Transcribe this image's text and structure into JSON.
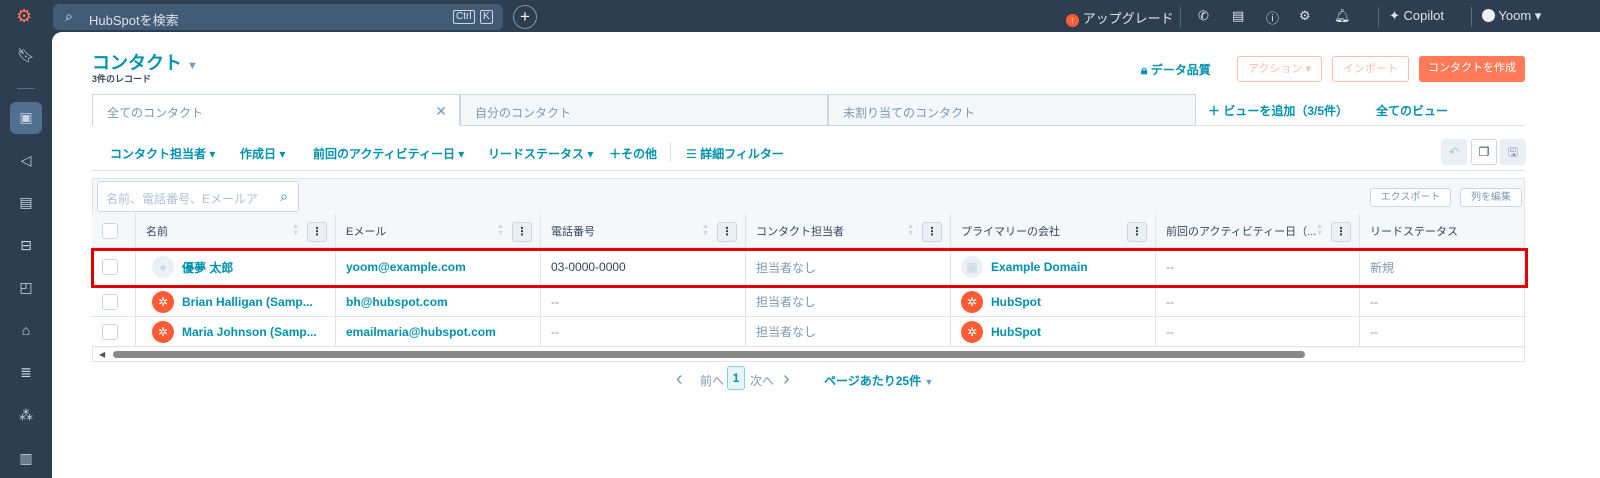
{
  "topbar": {
    "search_placeholder": "HubSpotを検索",
    "kbd_ctrl": "Ctrl",
    "kbd_k": "K",
    "upgrade": "アップグレード",
    "copilot": "Copilot",
    "user": "Yoom"
  },
  "header": {
    "title": "コンタクト",
    "record_count": "3件のレコード",
    "data_quality": "データ品質",
    "actions": "アクション",
    "import": "インポート",
    "create": "コンタクトを作成"
  },
  "tabs": [
    {
      "label": "全てのコンタクト"
    },
    {
      "label": "自分のコンタクト"
    },
    {
      "label": "未割り当てのコンタクト"
    }
  ],
  "add_view": "ビューを追加（3/5件）",
  "all_views": "全てのビュー",
  "filters": {
    "owner": "コンタクト担当者",
    "created": "作成日",
    "last_activity": "前回のアクティビティー日",
    "lead_status": "リードステータス",
    "more": "その他",
    "advanced": "詳細フィルター"
  },
  "table": {
    "search_placeholder": "名前、電話番号、Eメールア",
    "export": "エクスポート",
    "edit_columns": "列を編集",
    "columns": [
      "名前",
      "Eメール",
      "電話番号",
      "コンタクト担当者",
      "プライマリーの会社",
      "前回のアクティビティー日（...",
      "リードステータス"
    ],
    "rows": [
      {
        "name": "優夢 太郎",
        "email": "yoom@example.com",
        "phone": "03-0000-0000",
        "owner": "担当者なし",
        "company": "Example Domain",
        "last_activity": "--",
        "lead_status": "新規",
        "highlighted": true
      },
      {
        "name": "Brian Halligan (Samp...",
        "email": "bh@hubspot.com",
        "phone": "--",
        "owner": "担当者なし",
        "company": "HubSpot",
        "last_activity": "--",
        "lead_status": "--"
      },
      {
        "name": "Maria Johnson (Samp...",
        "email": "emailmaria@hubspot.com",
        "phone": "--",
        "owner": "担当者なし",
        "company": "HubSpot",
        "last_activity": "--",
        "lead_status": "--"
      }
    ]
  },
  "pagination": {
    "prev": "前へ",
    "page": "1",
    "next": "次へ",
    "per_page": "ページあたり25件"
  },
  "colors": {
    "accent": "#0091ae",
    "brand": "#ff7a59",
    "highlight": "#e00000"
  }
}
